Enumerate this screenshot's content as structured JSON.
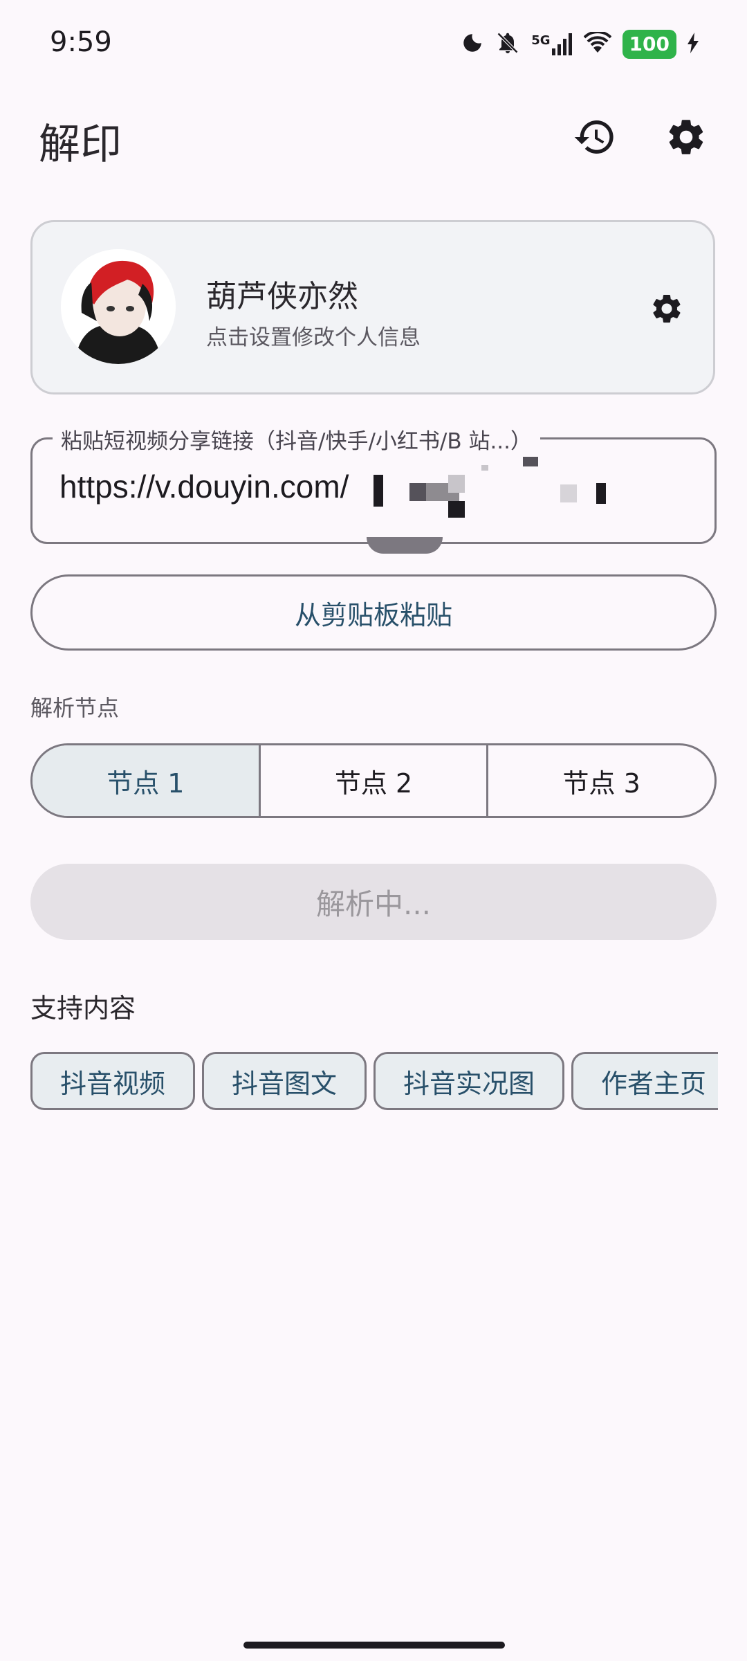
{
  "status_bar": {
    "time": "9:59",
    "network_label": "5G",
    "battery": "100",
    "icons": [
      "moon-icon",
      "bell-off-icon",
      "signal-icon",
      "wifi-icon",
      "battery-icon",
      "charging-icon"
    ]
  },
  "app_bar": {
    "title": "解印",
    "actions": [
      "history-icon",
      "settings-icon"
    ]
  },
  "profile": {
    "name": "葫芦侠亦然",
    "subtitle": "点击设置修改个人信息"
  },
  "url_field": {
    "label": "粘贴短视频分享链接（抖音/快手/小红书/B 站...）",
    "value": "https://v.douyin.com/"
  },
  "paste_button": {
    "label": "从剪贴板粘贴"
  },
  "nodes": {
    "label": "解析节点",
    "options": [
      "节点 1",
      "节点 2",
      "节点 3"
    ],
    "selected_index": 0
  },
  "parse_button": {
    "label": "解析中..."
  },
  "support": {
    "title": "支持内容",
    "chips": [
      "抖音视频",
      "抖音图文",
      "抖音实况图",
      "作者主页"
    ]
  },
  "colors": {
    "background": "#fcf8fc",
    "accent_text": "#28506a",
    "battery": "#2fb34a"
  }
}
